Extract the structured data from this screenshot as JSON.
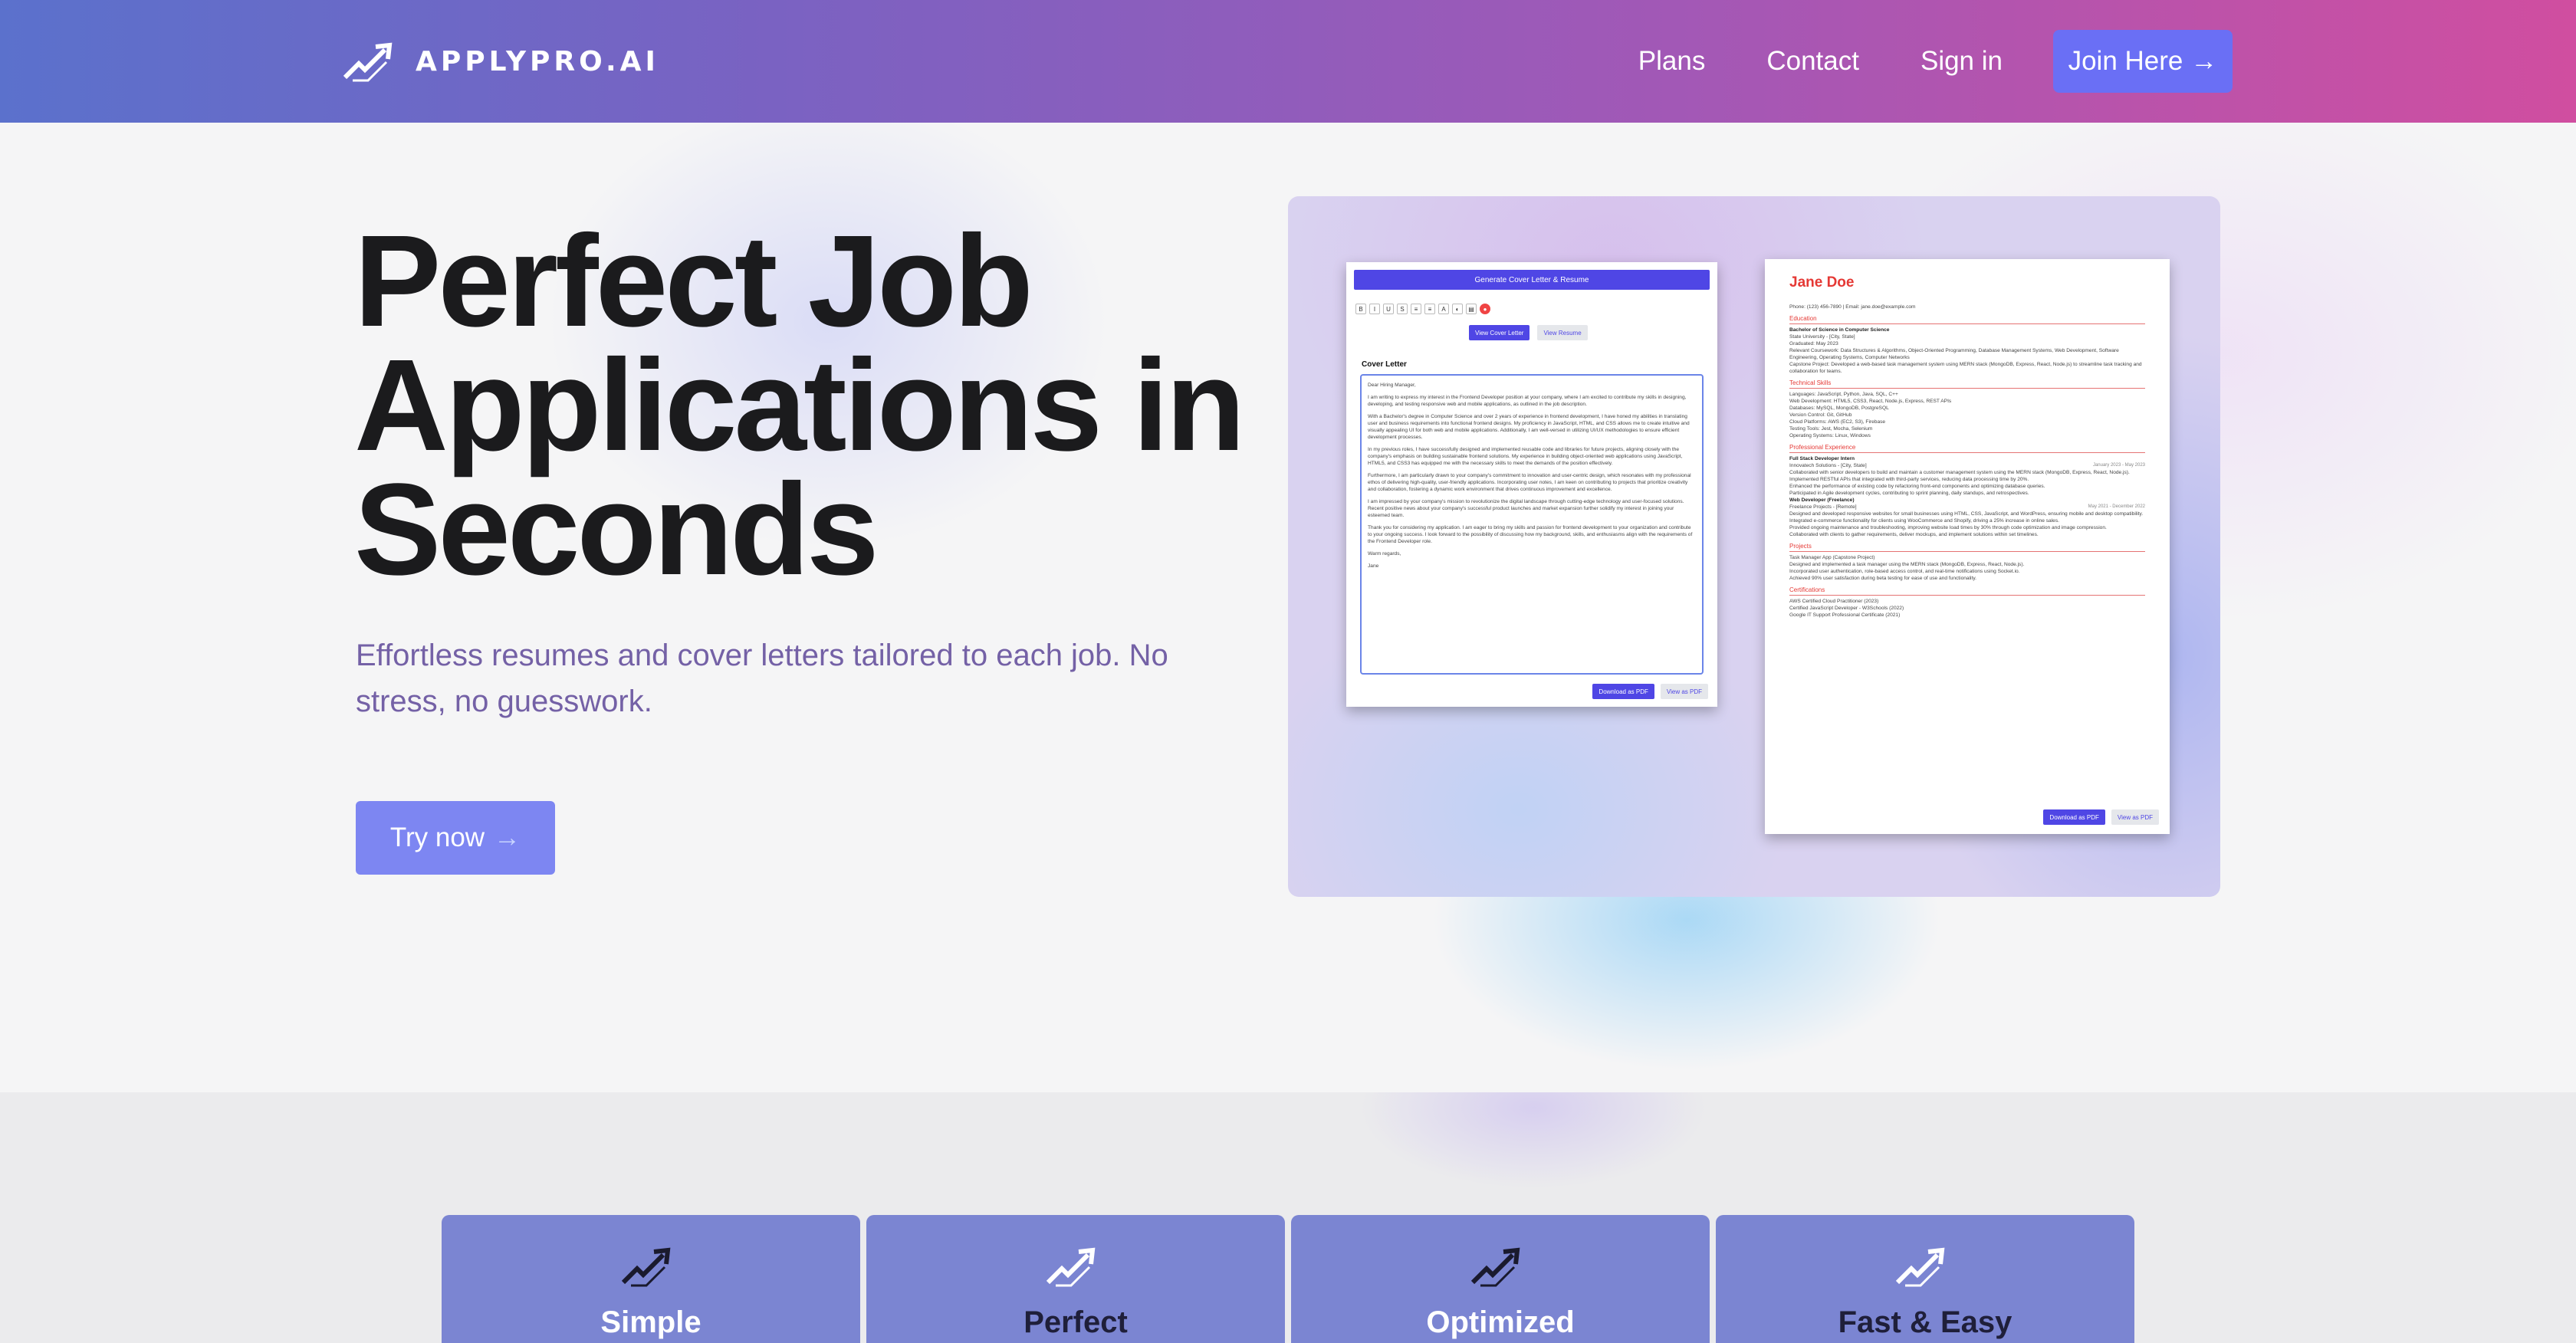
{
  "brand": {
    "logo_text": "APPLYPRO.AI",
    "primary": "#6a6ff5",
    "accent": "#7d86f2",
    "gradient_start": "#5b71cc",
    "gradient_end": "#d04ea0"
  },
  "nav": {
    "plans": "Plans",
    "contact": "Contact",
    "sign_in": "Sign in",
    "join": "Join Here",
    "join_icon": "arrow-right-icon"
  },
  "hero": {
    "headline_1": "Perfect Job",
    "headline_2": "Applications in",
    "headline_3": "Seconds",
    "subheadline": "Effortless resumes and cover letters tailored to each job. No stress, no guesswork.",
    "cta": "Try now"
  },
  "preview": {
    "cover_letter": {
      "generate_btn": "Generate Cover Letter & Resume",
      "toolbar": [
        "B",
        "I",
        "U",
        "S",
        "≡",
        "≡",
        "A",
        "◐",
        "▤"
      ],
      "tab_cover": "View Cover Letter",
      "tab_resume": "View Resume",
      "label": "Cover Letter",
      "paragraphs": [
        "Dear Hiring Manager,",
        "I am writing to express my interest in the Frontend Developer position at your company, where I am excited to contribute my skills in designing, developing, and testing responsive web and mobile applications, as outlined in the job description.",
        "With a Bachelor's degree in Computer Science and over 2 years of experience in frontend development, I have honed my abilities in translating user and business requirements into functional frontend designs. My proficiency in JavaScript, HTML, and CSS allows me to create intuitive and visually appealing UI for both web and mobile applications. Additionally, I am well-versed in utilizing UI/UX methodologies to ensure efficient development processes.",
        "In my previous roles, I have successfully designed and implemented reusable code and libraries for future projects, aligning closely with the company's emphasis on building sustainable frontend solutions. My experience in building object-oriented web applications using JavaScript, HTML5, and CSS3 has equipped me with the necessary skills to meet the demands of the position effectively.",
        "Furthermore, I am particularly drawn to your company's commitment to innovation and user-centric design, which resonates with my professional ethos of delivering high-quality, user-friendly applications. Incorporating user notes, I am keen on contributing to projects that prioritize creativity and collaboration, fostering a dynamic work environment that drives continuous improvement and excellence.",
        "I am impressed by your company's mission to revolutionize the digital landscape through cutting-edge technology and user-focused solutions. Recent positive news about your company's successful product launches and market expansion further solidify my interest in joining your esteemed team.",
        "Thank you for considering my application. I am eager to bring my skills and passion for frontend development to your organization and contribute to your ongoing success. I look forward to the possibility of discussing how my background, skills, and enthusiasms align with the requirements of the Frontend Developer role.",
        "Warm regards,",
        "Jane"
      ],
      "download_btn": "Download as PDF",
      "view_btn": "View as PDF"
    },
    "resume": {
      "name": "Jane Doe",
      "contact": "Phone: (123) 456-7890 | Email: jane.doe@example.com",
      "education_title": "Education",
      "degree": "Bachelor of Science in Computer Science",
      "school": "State University - [City, State]",
      "graduated": "Graduated: May 2023",
      "coursework": "Relevant Coursework: Data Structures & Algorithms, Object-Oriented Programming, Database Management Systems, Web Development, Software Engineering, Operating Systems, Computer Networks",
      "capstone": "Capstone Project: Developed a web-based task management system using MERN stack (MongoDB, Express, React, Node.js) to streamline task tracking and collaboration for teams.",
      "skills_title": "Technical Skills",
      "skills": [
        "Languages: JavaScript, Python, Java, SQL, C++",
        "Web Development: HTML5, CSS3, React, Node.js, Express, REST APIs",
        "Databases: MySQL, MongoDB, PostgreSQL",
        "Version Control: Git, GitHub",
        "Cloud Platforms: AWS (EC2, S3), Firebase",
        "Testing Tools: Jest, Mocha, Selenium",
        "Operating Systems: Linux, Windows"
      ],
      "experience_title": "Professional Experience",
      "job1_title": "Full Stack Developer Intern",
      "job1_company": "Innovatech Solutions - [City, State]",
      "job1_date": "January 2023 - May 2023",
      "job1_points": [
        "Collaborated with senior developers to build and maintain a customer management system using the MERN stack (MongoDB, Express, React, Node.js).",
        "Implemented RESTful APIs that integrated with third-party services, reducing data processing time by 20%.",
        "Enhanced the performance of existing code by refactoring front-end components and optimizing database queries.",
        "Participated in Agile development cycles, contributing to sprint planning, daily standups, and retrospectives."
      ],
      "job2_title": "Web Developer (Freelance)",
      "job2_company": "Freelance Projects - [Remote]",
      "job2_date": "May 2021 - December 2022",
      "job2_points": [
        "Designed and developed responsive websites for small businesses using HTML, CSS, JavaScript, and WordPress, ensuring mobile and desktop compatibility.",
        "Integrated e-commerce functionality for clients using WooCommerce and Shopify, driving a 25% increase in online sales.",
        "Provided ongoing maintenance and troubleshooting, improving website load times by 30% through code optimization and image compression.",
        "Collaborated with clients to gather requirements, deliver mockups, and implement solutions within set timelines."
      ],
      "projects_title": "Projects",
      "project_points": [
        "Task Manager App (Capstone Project)",
        "Designed and implemented a task manager using the MERN stack (MongoDB, Express, React, Node.js).",
        "Incorporated user authentication, role-based access control, and real-time notifications using Socket.io.",
        "Achieved 90% user satisfaction during beta testing for ease of use and functionality."
      ],
      "certifications_title": "Certifications",
      "certifications": [
        "AWS Certified Cloud Practitioner (2023)",
        "Certified JavaScript Developer - W3Schools (2022)",
        "Google IT Support Professional Certificate (2021)"
      ],
      "download_btn": "Download as PDF",
      "view_btn": "View as PDF"
    }
  },
  "features": [
    {
      "title": "Simple",
      "icon": "trend-arrow-icon"
    },
    {
      "title": "Perfect",
      "icon": "trend-arrow-icon"
    },
    {
      "title": "Optimized",
      "icon": "trend-arrow-icon"
    },
    {
      "title": "Fast & Easy",
      "icon": "trend-arrow-icon"
    }
  ]
}
